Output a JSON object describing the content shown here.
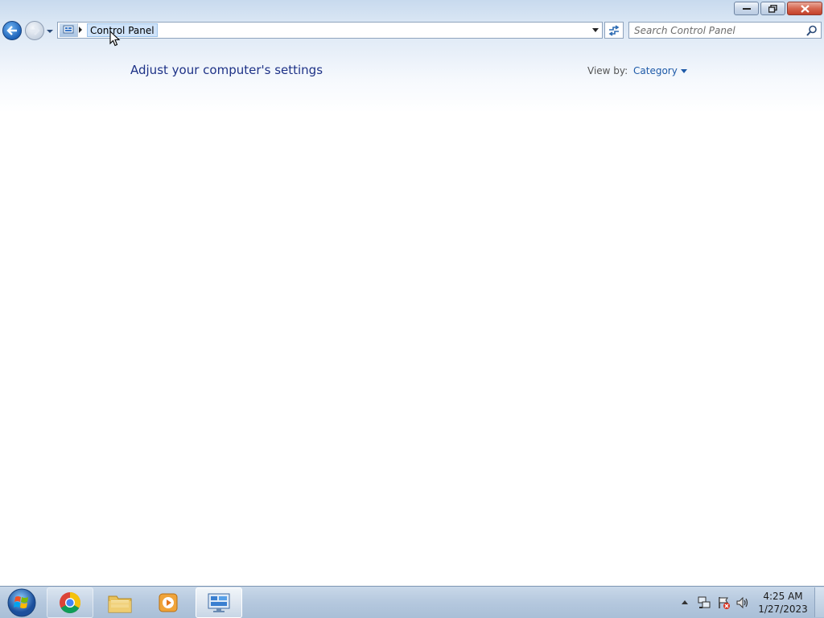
{
  "window": {
    "address": {
      "crumb": "Control Panel"
    },
    "search": {
      "placeholder": "Search Control Panel"
    },
    "controls": {
      "minimize": "minimize-icon",
      "restore": "restore-icon",
      "close": "close-icon"
    }
  },
  "main": {
    "title": "Adjust your computer's settings",
    "view_by_label": "View by:",
    "view_by_value": "Category"
  },
  "taskbar": {
    "apps": [
      "start-orb-icon",
      "chrome-icon",
      "file-explorer-icon",
      "media-player-icon",
      "control-panel-icon"
    ],
    "active_app": "control-panel-icon",
    "tray_icons": [
      "network-icon",
      "action-center-icon",
      "volume-icon"
    ],
    "clock": {
      "time": "4:25 AM",
      "date": "1/27/2023"
    }
  },
  "colors": {
    "title_text": "#1e3287",
    "link_text": "#1e5aa8",
    "close_button": "#c34029"
  }
}
